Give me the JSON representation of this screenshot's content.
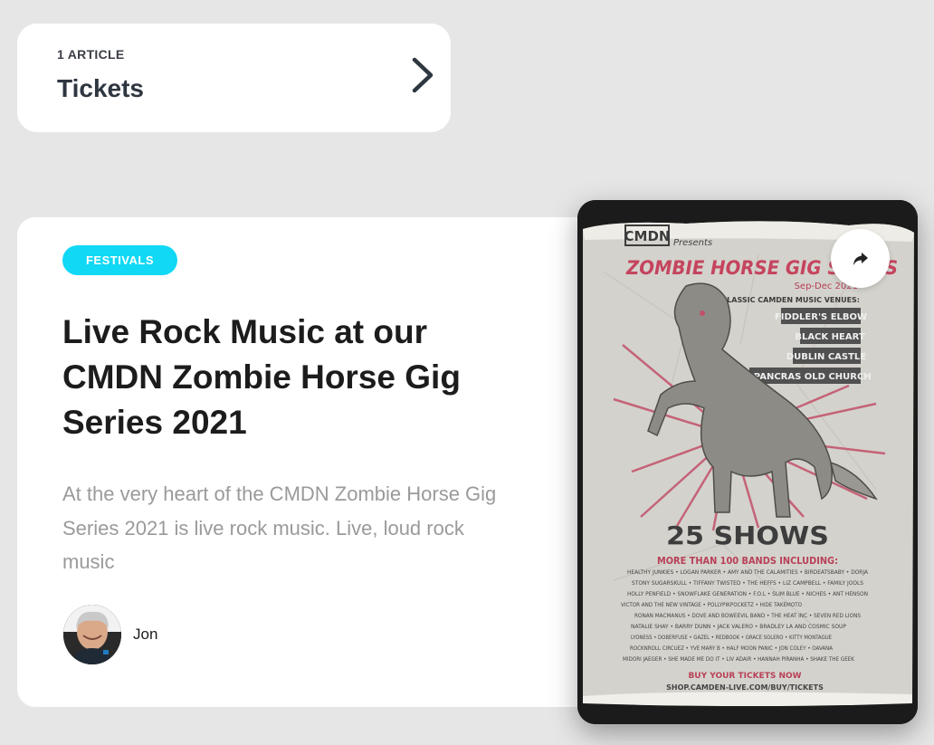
{
  "category": {
    "count_label": "1 ARTICLE",
    "title": "Tickets",
    "chevron_icon": "chevron-right-icon"
  },
  "article": {
    "tag": "FESTIVALS",
    "title": "Live Rock Music at our CMDN Zombie Horse Gig Series 2021",
    "excerpt": "At the very heart of the CMDN Zombie Horse Gig Series 2021 is live rock music. Live, loud rock music",
    "author": "Jon",
    "share_icon": "share-icon",
    "tag_color": "#10d8f5"
  },
  "poster": {
    "brand": "CMDN",
    "presents": "Presents",
    "headline": "ZOMBIE HORSE GIG SERIES",
    "dates": "Sep-Dec 2021",
    "venues_label": "4 CLASSIC CAMDEN MUSIC VENUES:",
    "venues": [
      "FIDDLER'S ELBOW",
      "BLACK HEART",
      "DUBLIN CASTLE",
      "ST PANCRAS OLD CHURCH"
    ],
    "shows": "25 SHOWS",
    "bands_label": "MORE THAN 100 BANDS INCLUDING:",
    "band_lines": [
      "HEALTHY JUNKIES • LOGAN PARKER • AMY AND THE CALAMITIES • BIRDEATSBABY • DORJA",
      "STONY SUGARSKULL • TIFFANY TWISTED • THE HEFFS • LIZ CAMPBELL • FAMILY JOOLS",
      "HOLLY PENFIELD • SNOWFLAKE GENERATION • F.O.L • SLIM BLUE • NICHES • ANT HENSON",
      "VICTOR AND THE NEW VINTAGE • POLLYPIKPOCKETZ • HIDE TAKEMOTO",
      "RONAN MACMANUS • DOVE AND BOWEEVIL BAND • THE HEAT INC • SEVEN RED LIONS",
      "NATALIE SHAY • BARRY DUNN • JACK VALERO • BRADLEY LA AND COSMIC SOUP",
      "LYONESS • DOBERFUSE • GAZEL • REDBOOK • GRACE SOLERO • KITTY MONTAGUE",
      "ROCKNROLL CIRCUEZ • YVE MARY B • HALF MOON PANIC • JON COLEY • OAVANA",
      "MIDORI JAEGER • SHE MADE ME DO IT • LIV ADAIR • HANNAH PIRANHA • SHAKE THE GEEK"
    ],
    "buy_label": "BUY YOUR TICKETS NOW",
    "shop_url": "SHOP.CAMDEN-LIVE.COM/BUY/TICKETS"
  }
}
